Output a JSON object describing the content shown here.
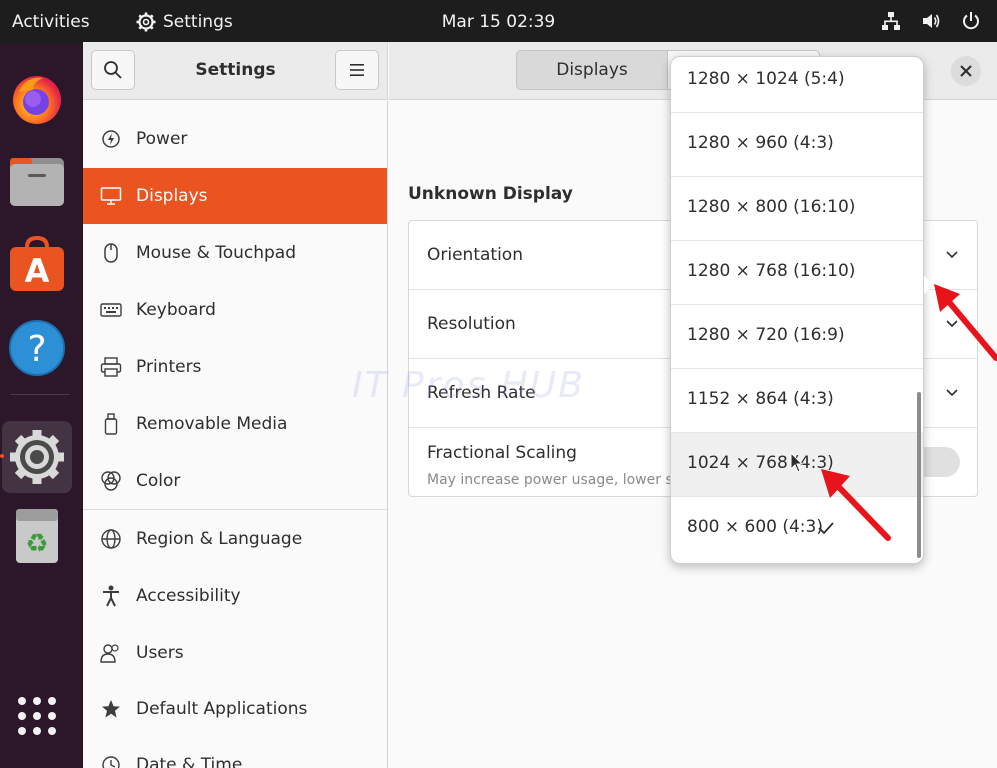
{
  "topbar": {
    "activities": "Activities",
    "app_name": "Settings",
    "clock": "Mar 15  02:39",
    "icons": [
      "network-icon",
      "volume-icon",
      "power-icon"
    ]
  },
  "dock": {
    "apps": [
      "Firefox",
      "Files",
      "Ubuntu Software",
      "Help",
      "Settings",
      "Trash",
      "Show Applications"
    ]
  },
  "header": {
    "title": "Settings",
    "view_switch": [
      "Displays",
      ""
    ]
  },
  "sidebar": {
    "items": [
      {
        "label": "Power",
        "icon": "power-icon"
      },
      {
        "label": "Displays",
        "icon": "display-icon",
        "selected": true
      },
      {
        "label": "Mouse & Touchpad",
        "icon": "mouse-icon"
      },
      {
        "label": "Keyboard",
        "icon": "keyboard-icon"
      },
      {
        "label": "Printers",
        "icon": "printer-icon"
      },
      {
        "label": "Removable Media",
        "icon": "removable-media-icon"
      },
      {
        "label": "Color",
        "icon": "color-icon"
      },
      {
        "label": "Region & Language",
        "icon": "globe-icon"
      },
      {
        "label": "Accessibility",
        "icon": "accessibility-icon"
      },
      {
        "label": "Users",
        "icon": "users-icon"
      },
      {
        "label": "Default Applications",
        "icon": "star-icon"
      },
      {
        "label": "Date & Time",
        "icon": "clock-icon"
      }
    ]
  },
  "main": {
    "section_title": "Unknown Display",
    "rows": [
      {
        "label": "Orientation"
      },
      {
        "label": "Resolution"
      },
      {
        "label": "Refresh Rate"
      },
      {
        "label": "Fractional Scaling",
        "sub": "May increase power usage, lower sp"
      }
    ]
  },
  "resolution_menu": {
    "options": [
      "1280 × 1024 (5:4)",
      "1280 × 960 (4:3)",
      "1280 × 800 (16:10)",
      "1280 × 768 (16:10)",
      "1280 × 720 (16:9)",
      "1152 × 864 (4:3)",
      "1024 × 768 (4:3)",
      "800 × 600 (4:3)"
    ],
    "selected": "800 × 600 (4:3)",
    "hovered": "1024 × 768 (4:3)"
  },
  "watermark": "IT Pros HUB",
  "colors": {
    "accent": "#e95420",
    "dock_bg": "#2b1729",
    "topbar_bg": "#1d1d1d",
    "annotation_arrow": "#e8141b"
  }
}
